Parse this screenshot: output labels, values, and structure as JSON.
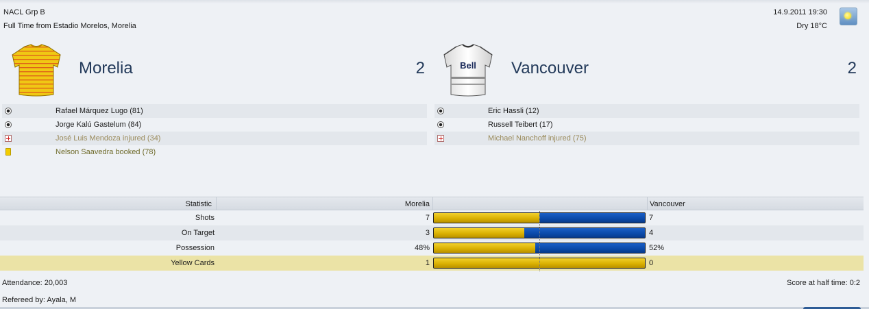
{
  "header": {
    "competition": "NACL Grp B",
    "venue_line": "Full Time from Estadio Morelos, Morelia",
    "datetime": "14.9.2011 19:30",
    "weather": "Dry 18°C",
    "weather_icon": "sun-icon"
  },
  "home": {
    "name": "Morelia",
    "score": "2",
    "kit_colors": {
      "primary": "#f0c814",
      "stripe": "#d94a1a"
    },
    "events": [
      {
        "type": "goal",
        "icon": "ball-icon",
        "text": "Rafael Márquez Lugo (81)"
      },
      {
        "type": "goal",
        "icon": "ball-icon",
        "text": "Jorge Kalú Gastelum (84)"
      },
      {
        "type": "injury",
        "icon": "injury-icon",
        "text": "José Luis Mendoza injured (34)"
      },
      {
        "type": "booking",
        "icon": "yellow-card-icon",
        "text": "Nelson Saavedra booked (78)"
      }
    ]
  },
  "away": {
    "name": "Vancouver",
    "score": "2",
    "kit_colors": {
      "primary": "#f2f2f2",
      "sponsor_text": "Bell"
    },
    "events": [
      {
        "type": "goal",
        "icon": "ball-icon",
        "text": "Eric Hassli (12)"
      },
      {
        "type": "goal",
        "icon": "ball-icon",
        "text": "Russell Teibert (17)"
      },
      {
        "type": "injury",
        "icon": "injury-icon",
        "text": "Michael Nanchoff injured (75)"
      }
    ]
  },
  "stats": {
    "col_statistic": "Statistic",
    "col_home": "Morelia",
    "col_away": "Vancouver",
    "colors": {
      "home": "#e0b808",
      "away": "#0b49a8"
    },
    "rows": [
      {
        "label": "Shots",
        "home": "7",
        "away": "7",
        "home_share": 0.5
      },
      {
        "label": "On Target",
        "home": "3",
        "away": "4",
        "home_share": 0.4286
      },
      {
        "label": "Possession",
        "home": "48%",
        "away": "52%",
        "home_share": 0.48
      },
      {
        "label": "Yellow Cards",
        "home": "1",
        "away": "0",
        "home_share": 1.0
      }
    ]
  },
  "footer": {
    "attendance": "Attendance: 20,003",
    "referee": "Refereed by: Ayala, M",
    "halftime": "Score at half time: 0:2"
  }
}
